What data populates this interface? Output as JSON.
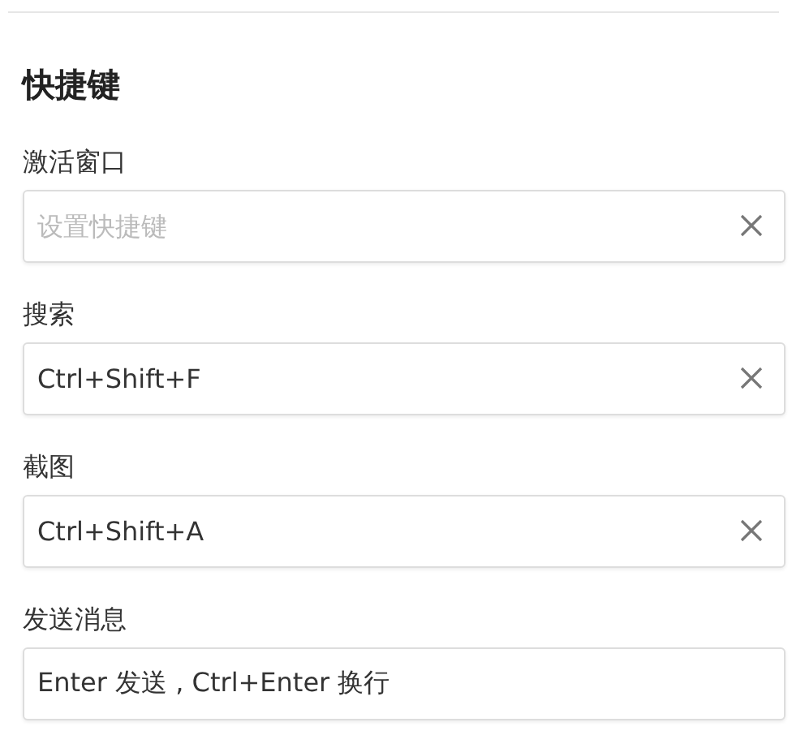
{
  "section_title": "快捷键",
  "shortcuts": [
    {
      "label": "激活窗口",
      "kind": "clearable",
      "placeholder": "设置快捷键"
    },
    {
      "label": "搜索",
      "kind": "clearable",
      "value": "Ctrl+Shift+F"
    },
    {
      "label": "截图",
      "kind": "clearable",
      "value": "Ctrl+Shift+A"
    },
    {
      "label": "发送消息",
      "kind": "plain",
      "value": "Enter 发送 , Ctrl+Enter 换行"
    }
  ]
}
